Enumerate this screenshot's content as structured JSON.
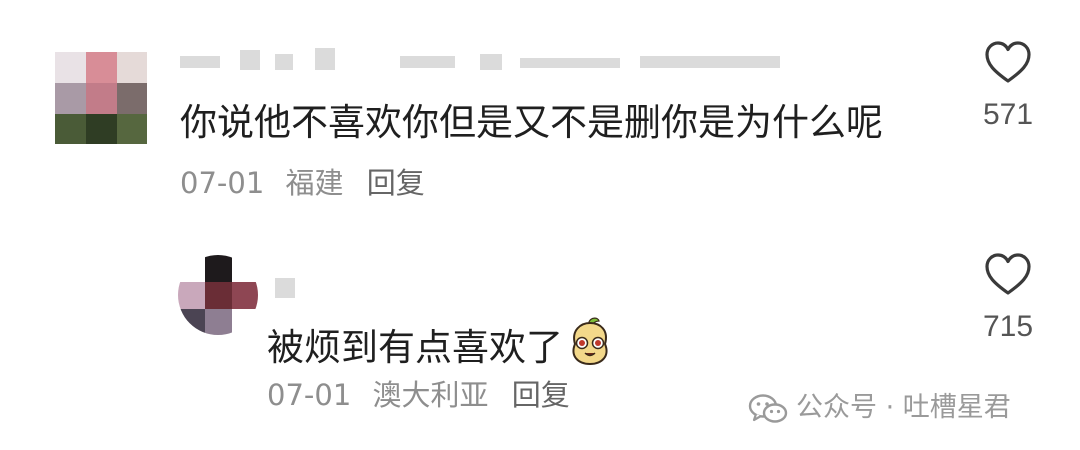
{
  "comments": [
    {
      "text": "你说他不喜欢你但是又不是删你是为什么呢",
      "date": "07-01",
      "location": "福建",
      "reply_label": "回复",
      "likes": "571"
    },
    {
      "text": "被烦到有点喜欢了",
      "date": "07-01",
      "location": "澳大利亚",
      "reply_label": "回复",
      "likes": "715"
    }
  ],
  "watermark": "公众号 · 吐槽星君",
  "icons": {
    "like": "heart-outline-icon",
    "emoji": "smiling-bean-emoji",
    "watermark": "wechat-icon"
  },
  "colors": {
    "text": "#1f1f1f",
    "meta": "#8e8e8e",
    "icon": "#3a3a3a"
  }
}
